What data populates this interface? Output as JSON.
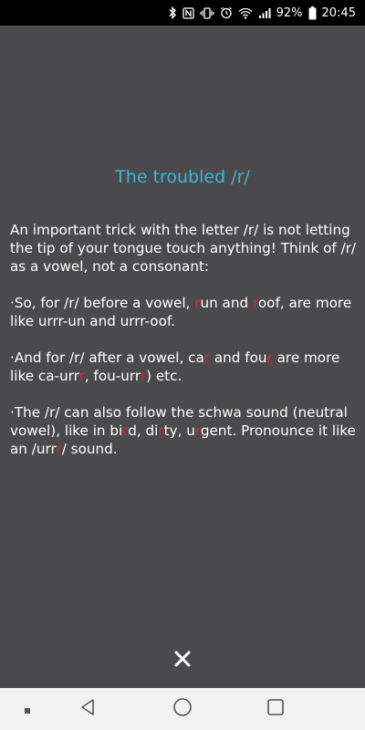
{
  "status_bar": {
    "battery": "92%",
    "time": "20:45",
    "icons": [
      "bluetooth-icon",
      "nfc-icon",
      "vibrate-icon",
      "alarm-icon",
      "wifi-icon",
      "signal-icon",
      "battery-icon"
    ]
  },
  "title": "The troubled /r/",
  "paragraphs": {
    "p1": "An important trick with the letter /r/ is not letting the tip of your tongue touch anything! Think of /r/ as a vowel, not a consonant:",
    "p2": {
      "a": "·So, for /r/ before a vowel, ",
      "r1": "r",
      "b": "un and ",
      "r2": "r",
      "c": "oof, are more like urrr-un and urrr-oof."
    },
    "p3": {
      "a": "·And for /r/ after a vowel, ca",
      "r1": "r",
      "b": " and fou",
      "r2": "r",
      "c": " are more like ca-urr",
      "r3": "r",
      "d": ", fou-urr",
      "r4": "r",
      "e": ") etc."
    },
    "p4": {
      "a": "·The /r/ can also follow the schwa sound (neutral vowel), like in bi",
      "r1": "r",
      "b": "d, di",
      "r2": "r",
      "c": "ty, u",
      "r3": "r",
      "d": "gent. Pronounce it like an /urr",
      "r4": "r",
      "e": "/ sound."
    }
  },
  "colors": {
    "background": "#4a4a4c",
    "title": "#3cb5d8",
    "highlight": "#d42a2a"
  },
  "icons": {
    "close": "close-icon",
    "nav": [
      "recents-dot-icon",
      "back-icon",
      "home-icon",
      "overview-icon"
    ]
  }
}
